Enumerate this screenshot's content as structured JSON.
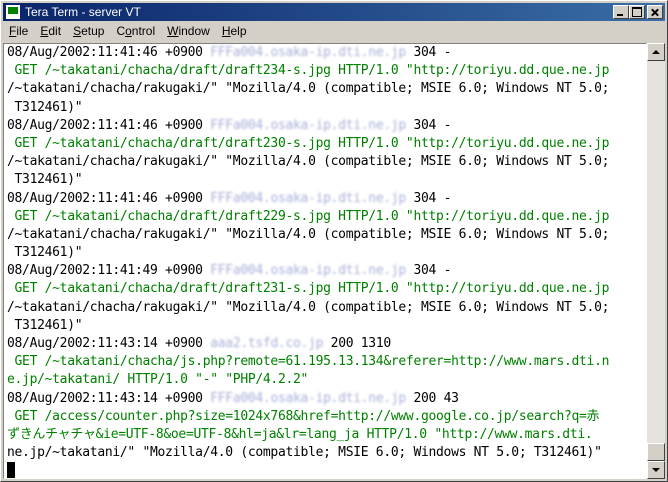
{
  "window": {
    "title": "Tera Term - server VT"
  },
  "menu": [
    {
      "pre": "",
      "acc": "F",
      "post": "ile"
    },
    {
      "pre": "",
      "acc": "E",
      "post": "dit"
    },
    {
      "pre": "",
      "acc": "S",
      "post": "etup"
    },
    {
      "pre": "C",
      "acc": "o",
      "post": "ntrol"
    },
    {
      "pre": "",
      "acc": "W",
      "post": "indow"
    },
    {
      "pre": "",
      "acc": "H",
      "post": "elp"
    }
  ],
  "log": [
    {
      "kind": "entry",
      "ts": "08/Aug/2002:11:41:46 +0900",
      "host": "FFFa004.osaka-ip.dti.ne.jp",
      "status": "304 -"
    },
    {
      "kind": "req",
      "text": " GET /~takatani/chacha/draft/draft234-s.jpg HTTP/1.0 \"http://toriyu.dd.que.ne.jp"
    },
    {
      "kind": "cont",
      "text": "/~takatani/chacha/rakugaki/\" \"Mozilla/4.0 (compatible; MSIE 6.0; Windows NT 5.0;"
    },
    {
      "kind": "cont",
      "text": " T312461)\""
    },
    {
      "kind": "entry",
      "ts": "08/Aug/2002:11:41:46 +0900",
      "host": "FFFa004.osaka-ip.dti.ne.jp",
      "status": "304 -"
    },
    {
      "kind": "req",
      "text": " GET /~takatani/chacha/draft/draft230-s.jpg HTTP/1.0 \"http://toriyu.dd.que.ne.jp"
    },
    {
      "kind": "cont",
      "text": "/~takatani/chacha/rakugaki/\" \"Mozilla/4.0 (compatible; MSIE 6.0; Windows NT 5.0;"
    },
    {
      "kind": "cont",
      "text": " T312461)\""
    },
    {
      "kind": "entry",
      "ts": "08/Aug/2002:11:41:46 +0900",
      "host": "FFFa004.osaka-ip.dti.ne.jp",
      "status": "304 -"
    },
    {
      "kind": "req",
      "text": " GET /~takatani/chacha/draft/draft229-s.jpg HTTP/1.0 \"http://toriyu.dd.que.ne.jp"
    },
    {
      "kind": "cont",
      "text": "/~takatani/chacha/rakugaki/\" \"Mozilla/4.0 (compatible; MSIE 6.0; Windows NT 5.0;"
    },
    {
      "kind": "cont",
      "text": " T312461)\""
    },
    {
      "kind": "entry",
      "ts": "08/Aug/2002:11:41:49 +0900",
      "host": "FFFa004.osaka-ip.dti.ne.jp",
      "status": "304 -"
    },
    {
      "kind": "req",
      "text": " GET /~takatani/chacha/draft/draft231-s.jpg HTTP/1.0 \"http://toriyu.dd.que.ne.jp"
    },
    {
      "kind": "cont",
      "text": "/~takatani/chacha/rakugaki/\" \"Mozilla/4.0 (compatible; MSIE 6.0; Windows NT 5.0;"
    },
    {
      "kind": "cont",
      "text": " T312461)\""
    },
    {
      "kind": "entry",
      "ts": "08/Aug/2002:11:43:14 +0900",
      "host": "aaa2.tsfd.co.jp",
      "status": "200 1310"
    },
    {
      "kind": "req",
      "text": " GET /~takatani/chacha/js.php?remote=61.195.13.134&referer=http://www.mars.dti.n"
    },
    {
      "kind": "req",
      "text": "e.jp/~takatani/ HTTP/1.0 \"-\" \"PHP/4.2.2\""
    },
    {
      "kind": "entry",
      "ts": "08/Aug/2002:11:43:14 +0900",
      "host": "FFFa004.osaka-ip.dti.ne.jp",
      "status": "200 43"
    },
    {
      "kind": "req",
      "text": " GET /access/counter.php?size=1024x768&href=http://www.google.co.jp/search?q=赤"
    },
    {
      "kind": "req",
      "text": "ずきんチャチャ&ie=UTF-8&oe=UTF-8&hl=ja&lr=lang_ja HTTP/1.0 \"http://www.mars.dti."
    },
    {
      "kind": "cont",
      "text": "ne.jp/~takatani/\" \"Mozilla/4.0 (compatible; MSIE 6.0; Windows NT 5.0; T312461)\""
    }
  ]
}
